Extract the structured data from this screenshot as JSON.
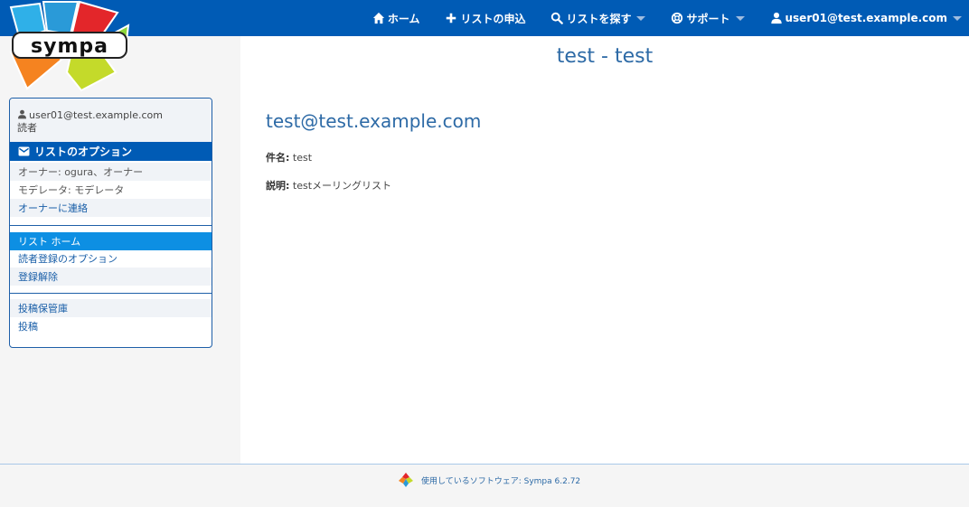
{
  "nav": {
    "home": "ホーム",
    "request_list": "リストの申込",
    "search_lists": "リストを探す",
    "support": "サポート",
    "user": "user01@test.example.com"
  },
  "logo": {
    "text": "sympa"
  },
  "page": {
    "title": "test - test",
    "list_address": "test@test.example.com",
    "subject_label": "件名:",
    "subject_value": "test",
    "description_label": "説明:",
    "description_value": "testメーリングリスト"
  },
  "sidebar": {
    "user_email": "user01@test.example.com",
    "user_role": "読者",
    "options_header": "リストのオプション",
    "owner": "オーナー: ogura、オーナー",
    "moderator": "モデレータ: モデレータ",
    "contact_owner": "オーナーに連絡",
    "list_home": "リスト ホーム",
    "subscriber_options": "読者登録のオプション",
    "unsubscribe": "登録解除",
    "archives": "投稿保管庫",
    "post": "投稿"
  },
  "footer": {
    "text": "使用しているソフトウェア: Sympa 6.2.72"
  },
  "colors": {
    "topbar": "#005bb5",
    "active_item": "#0d8fe3",
    "link": "#1a5fa8",
    "title": "#2d6aa6"
  }
}
